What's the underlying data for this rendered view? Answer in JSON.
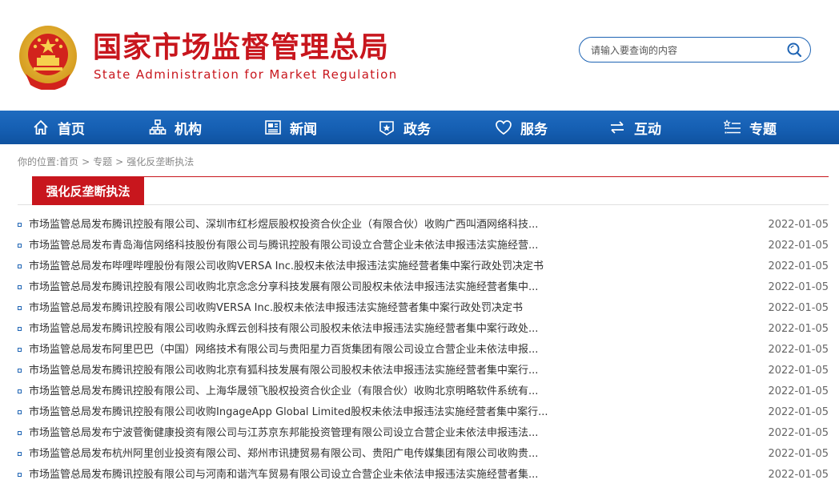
{
  "header": {
    "title_cn": "国家市场监督管理总局",
    "title_en": "State Administration for Market Regulation",
    "search_placeholder": "请输入要查询的内容",
    "brand_color": "#c8161d",
    "accent_color": "#1e64b4"
  },
  "nav": [
    {
      "label": "首页",
      "icon": "home-icon"
    },
    {
      "label": "机构",
      "icon": "org-icon"
    },
    {
      "label": "新闻",
      "icon": "news-icon"
    },
    {
      "label": "政务",
      "icon": "gov-icon"
    },
    {
      "label": "服务",
      "icon": "heart-icon"
    },
    {
      "label": "互动",
      "icon": "exchange-icon"
    },
    {
      "label": "专题",
      "icon": "list-icon"
    }
  ],
  "breadcrumb": {
    "prefix": "你的位置:",
    "items": [
      "首页",
      "专题",
      "强化反垄断执法"
    ]
  },
  "section": {
    "title": "强化反垄断执法"
  },
  "articles": [
    {
      "title": "市场监管总局发布腾讯控股有限公司、深圳市红杉煜辰股权投资合伙企业（有限合伙）收购广西叫酒网络科技...",
      "date": "2022-01-05"
    },
    {
      "title": "市场监管总局发布青岛海信网络科技股份有限公司与腾讯控股有限公司设立合营企业未依法申报违法实施经营...",
      "date": "2022-01-05"
    },
    {
      "title": "市场监管总局发布哔哩哔哩股份有限公司收购VERSA Inc.股权未依法申报违法实施经营者集中案行政处罚决定书",
      "date": "2022-01-05"
    },
    {
      "title": "市场监管总局发布腾讯控股有限公司收购北京念念分享科技发展有限公司股权未依法申报违法实施经营者集中...",
      "date": "2022-01-05"
    },
    {
      "title": "市场监管总局发布腾讯控股有限公司收购VERSA Inc.股权未依法申报违法实施经营者集中案行政处罚决定书",
      "date": "2022-01-05"
    },
    {
      "title": "市场监管总局发布腾讯控股有限公司收购永辉云创科技有限公司股权未依法申报违法实施经营者集中案行政处...",
      "date": "2022-01-05"
    },
    {
      "title": "市场监管总局发布阿里巴巴（中国）网络技术有限公司与贵阳星力百货集团有限公司设立合营企业未依法申报...",
      "date": "2022-01-05"
    },
    {
      "title": "市场监管总局发布腾讯控股有限公司收购北京有狐科技发展有限公司股权未依法申报违法实施经营者集中案行...",
      "date": "2022-01-05"
    },
    {
      "title": "市场监管总局发布腾讯控股有限公司、上海华晟领飞股权投资合伙企业（有限合伙）收购北京明略软件系统有...",
      "date": "2022-01-05"
    },
    {
      "title": "市场监管总局发布腾讯控股有限公司收购IngageApp Global Limited股权未依法申报违法实施经营者集中案行...",
      "date": "2022-01-05"
    },
    {
      "title": "市场监管总局发布宁波菅衡健康投资有限公司与江苏京东邦能投资管理有限公司设立合营企业未依法申报违法...",
      "date": "2022-01-05"
    },
    {
      "title": "市场监管总局发布杭州阿里创业投资有限公司、郑州市讯捷贸易有限公司、贵阳广电传媒集团有限公司收购贵...",
      "date": "2022-01-05"
    },
    {
      "title": "市场监管总局发布腾讯控股有限公司与河南和谐汽车贸易有限公司设立合营企业未依法申报违法实施经营者集...",
      "date": "2022-01-05"
    }
  ]
}
